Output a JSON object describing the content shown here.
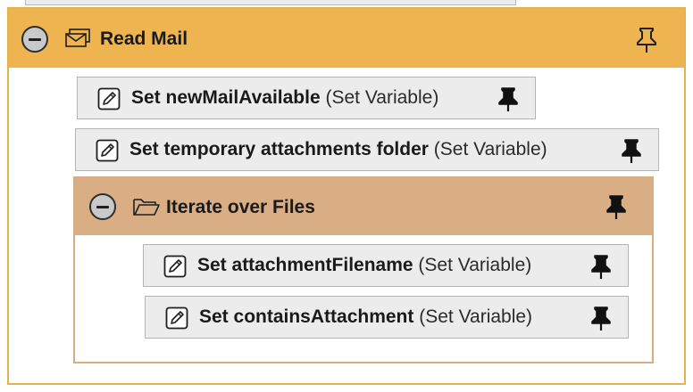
{
  "workflow": {
    "group": {
      "title": "Read Mail",
      "icons": {
        "collapse": "minus-circle-icon",
        "group": "mail-stack-icon",
        "pin": "pin-outline-icon"
      },
      "steps": [
        {
          "name": "Set newMailAvailable",
          "type": "(Set Variable)",
          "icon": "edit-icon",
          "pin": "pin-filled-icon"
        },
        {
          "name": "Set temporary attachments folder",
          "type": "(Set Variable)",
          "icon": "edit-icon",
          "pin": "pin-filled-icon"
        }
      ],
      "loop": {
        "title": "Iterate over Files",
        "icons": {
          "collapse": "minus-circle-icon",
          "group": "folder-open-icon",
          "pin": "pin-filled-icon"
        },
        "steps": [
          {
            "name": "Set attachmentFilename",
            "type": "(Set Variable)",
            "icon": "edit-icon",
            "pin": "pin-filled-icon"
          },
          {
            "name": "Set containsAttachment",
            "type": "(Set Variable)",
            "icon": "edit-icon",
            "pin": "pin-filled-icon"
          }
        ]
      }
    }
  },
  "colors": {
    "outer_header": "#edb44f",
    "inner_header": "#d9ae84",
    "step_background": "#ececec"
  }
}
